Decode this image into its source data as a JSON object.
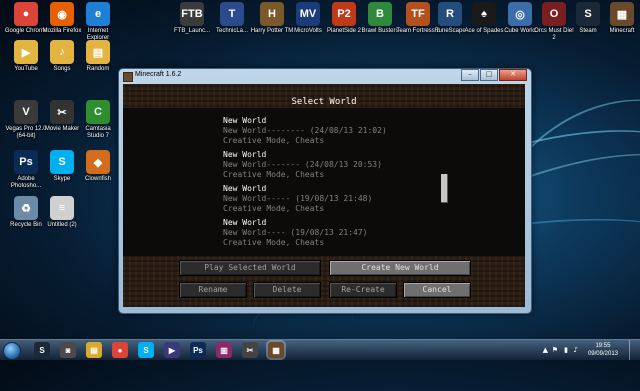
{
  "desktop": {
    "icons": [
      {
        "label": "Google Chrome",
        "glyph": "●",
        "color": "#db4437"
      },
      {
        "label": "Mozilla Firefox",
        "glyph": "◉",
        "color": "#e66000"
      },
      {
        "label": "Internet Explorer",
        "glyph": "e",
        "color": "#1e7fd6"
      },
      {
        "label": "YouTube",
        "glyph": "▶",
        "color": "#e4b440"
      },
      {
        "label": "Songs",
        "glyph": "♪",
        "color": "#e4b440"
      },
      {
        "label": "Random",
        "glyph": "▤",
        "color": "#e4b440"
      },
      {
        "label": "Vegas Pro 12.0 (64-bit)",
        "glyph": "V",
        "color": "#3a3a3a"
      },
      {
        "label": "Movie Maker",
        "glyph": "✂",
        "color": "#333333"
      },
      {
        "label": "Camtasia Studio 7",
        "glyph": "C",
        "color": "#2f8f2f"
      },
      {
        "label": "Adobe Photosho...",
        "glyph": "Ps",
        "color": "#0a2b55"
      },
      {
        "label": "Skype",
        "glyph": "S",
        "color": "#00aff0"
      },
      {
        "label": "Clownfish",
        "glyph": "◆",
        "color": "#d36c1c"
      },
      {
        "label": "Recycle Bin",
        "glyph": "♻",
        "color": "#6d8aa8"
      },
      {
        "label": "Untitled (2)",
        "glyph": "≡",
        "color": "#d0d0d0"
      },
      {
        "label": "FTB_Launc...",
        "glyph": "FTB",
        "color": "#3b3b3b"
      },
      {
        "label": "TechnicLa...",
        "glyph": "T",
        "color": "#2b4b8c"
      },
      {
        "label": "Harry Potter TM",
        "glyph": "H",
        "color": "#7a5a2a"
      },
      {
        "label": "MicroVolts",
        "glyph": "MV",
        "color": "#1b3c7a"
      },
      {
        "label": "PlanetSide 2",
        "glyph": "P2",
        "color": "#c03a1a"
      },
      {
        "label": "Brawl Busters",
        "glyph": "B",
        "color": "#2e8a3a"
      },
      {
        "label": "Team Fortress 2",
        "glyph": "TF",
        "color": "#b5501e"
      },
      {
        "label": "RuneScape",
        "glyph": "R",
        "color": "#234d7a"
      },
      {
        "label": "Ace of Spades",
        "glyph": "♠",
        "color": "#1a1a1a"
      },
      {
        "label": "Cube World",
        "glyph": "◎",
        "color": "#3b6ea8"
      },
      {
        "label": "Orcs Must Die! 2",
        "glyph": "O",
        "color": "#7a1f1f"
      },
      {
        "label": "Steam",
        "glyph": "S",
        "color": "#1b2838"
      },
      {
        "label": "Minecraft",
        "glyph": "▦",
        "color": "#6b4a2b"
      }
    ]
  },
  "window": {
    "title": "Minecraft 1.6.2",
    "minimize_glyph": "–",
    "maximize_glyph": "□",
    "close_glyph": "✕",
    "game": {
      "screen_title": "Select World",
      "worlds": [
        {
          "name": "New World",
          "detail": "New World-------- (24/08/13 21:02)",
          "mode": "Creative Mode, Cheats"
        },
        {
          "name": "New World",
          "detail": "New World------- (24/08/13 20:53)",
          "mode": "Creative Mode, Cheats"
        },
        {
          "name": "New World",
          "detail": "New World----- (19/08/13 21:48)",
          "mode": "Creative Mode, Cheats"
        },
        {
          "name": "New World",
          "detail": "New World---- (19/08/13 21:47)",
          "mode": "Creative Mode, Cheats"
        }
      ],
      "buttons": {
        "play": "Play Selected World",
        "create": "Create New World",
        "rename": "Rename",
        "delete": "Delete",
        "recreate": "Re-Create",
        "cancel": "Cancel"
      }
    }
  },
  "taskbar": {
    "items": [
      {
        "name": "steam-taskbar-icon",
        "glyph": "S",
        "color": "#1b2838"
      },
      {
        "name": "teamspeak-taskbar-icon",
        "glyph": "◙",
        "color": "#4a4a4a"
      },
      {
        "name": "folder-taskbar-icon",
        "glyph": "▤",
        "color": "#d9a930"
      },
      {
        "name": "chrome-taskbar-icon",
        "glyph": "●",
        "color": "#db4437"
      },
      {
        "name": "skype-taskbar-icon",
        "glyph": "S",
        "color": "#00aff0"
      },
      {
        "name": "media-taskbar-icon",
        "glyph": "▶",
        "color": "#3a3a7a"
      },
      {
        "name": "photoshop-taskbar-icon",
        "glyph": "Ps",
        "color": "#0a2b55"
      },
      {
        "name": "winrar-taskbar-icon",
        "glyph": "▥",
        "color": "#8a2a6a"
      },
      {
        "name": "movie-maker-taskbar-icon",
        "glyph": "✂",
        "color": "#444444"
      },
      {
        "name": "minecraft-taskbar-icon",
        "glyph": "▦",
        "color": "#6b4a2b"
      }
    ],
    "time": "19:55",
    "date": "09/09/2013",
    "tray_glyphs": [
      "▲",
      "⚑",
      "▮",
      "♪"
    ]
  }
}
